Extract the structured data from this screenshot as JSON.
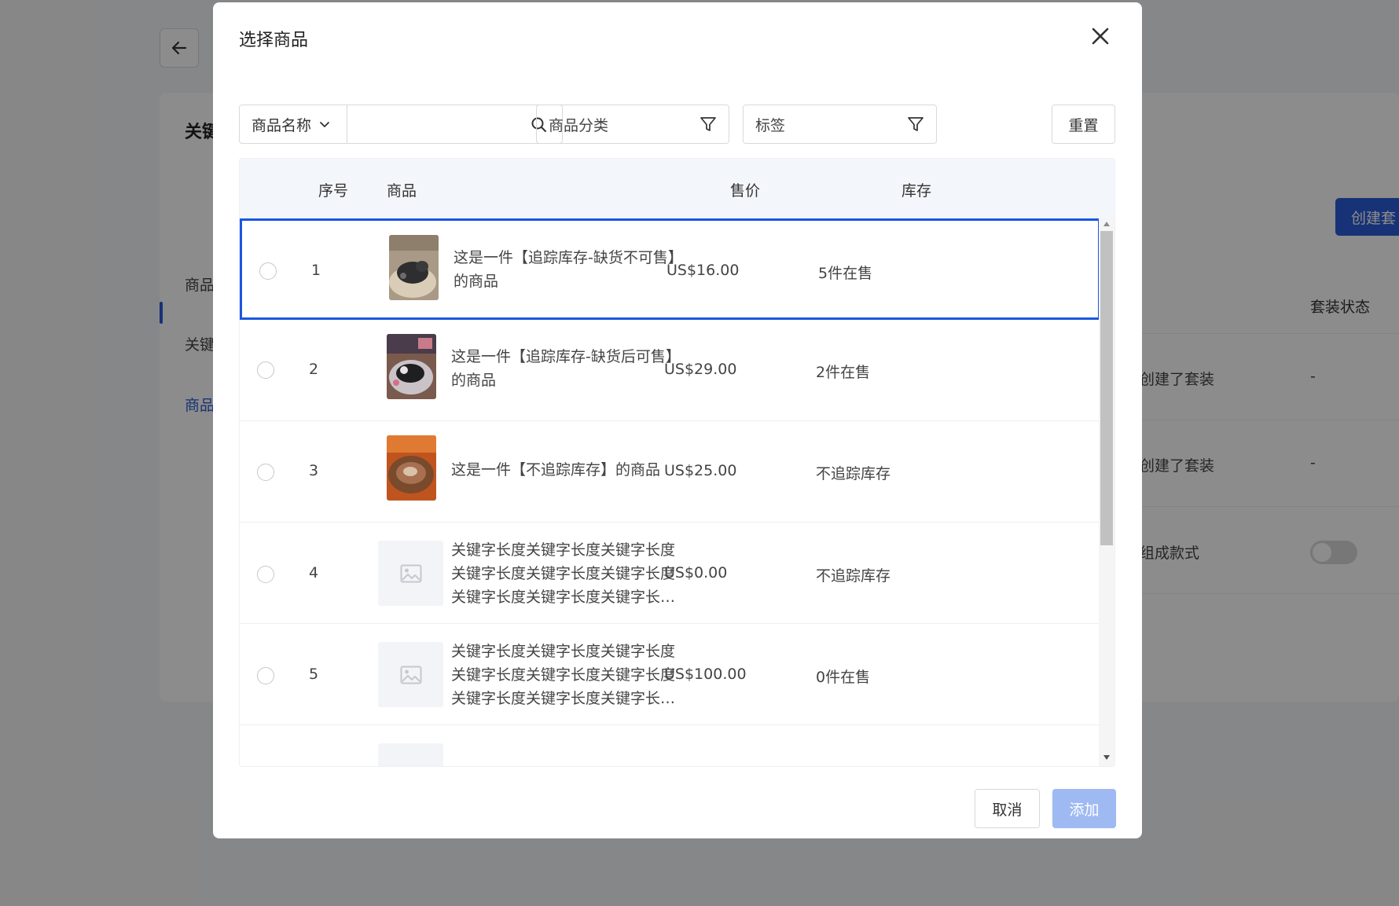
{
  "background": {
    "card_title": "关键",
    "tabs": [
      "商品",
      "关键",
      "商品"
    ],
    "create_button": "创建套",
    "column_status": "套装状态",
    "rows": [
      {
        "desc": "创建了套装",
        "status": "-"
      },
      {
        "desc": "创建了套装",
        "status": "-"
      },
      {
        "desc": "组成款式",
        "status": ""
      }
    ]
  },
  "modal": {
    "title": "选择商品",
    "search": {
      "field_label": "商品名称",
      "placeholder": "",
      "category_placeholder": "商品分类",
      "tag_placeholder": "标签",
      "reset_label": "重置"
    },
    "columns": {
      "index": "序号",
      "product": "商品",
      "price": "售价",
      "stock": "库存"
    },
    "rows": [
      {
        "index": "1",
        "name": "这是一件【追踪库存-缺货不可售】的商品",
        "price": "US$16.00",
        "stock": "5件在售",
        "image": "photo-dog-gray",
        "selected": true
      },
      {
        "index": "2",
        "name": "这是一件【追踪库存-缺货后可售】的商品",
        "price": "US$29.00",
        "stock": "2件在售",
        "image": "photo-dog-bed",
        "selected": false
      },
      {
        "index": "3",
        "name": "这是一件【不追踪库存】的商品",
        "price": "US$25.00",
        "stock": "不追踪库存",
        "image": "photo-pet-bed-brown",
        "selected": false
      },
      {
        "index": "4",
        "name": "关键字长度关键字长度关键字长度关键字长度关键字长度关键字长度关键字长度关键字长度关键字长…",
        "price": "US$0.00",
        "stock": "不追踪库存",
        "image": "image-placeholder-icon",
        "selected": false
      },
      {
        "index": "5",
        "name": "关键字长度关键字长度关键字长度关键字长度关键字长度关键字长度关键字长度关键字长度关键字长…",
        "price": "US$100.00",
        "stock": "0件在售",
        "image": "image-placeholder-icon",
        "selected": false
      }
    ],
    "cancel_label": "取消",
    "add_label": "添加"
  },
  "colors": {
    "primary": "#1a56e0",
    "add_disabled": "#9fbaf2",
    "header_bg": "#f3f6fb"
  }
}
